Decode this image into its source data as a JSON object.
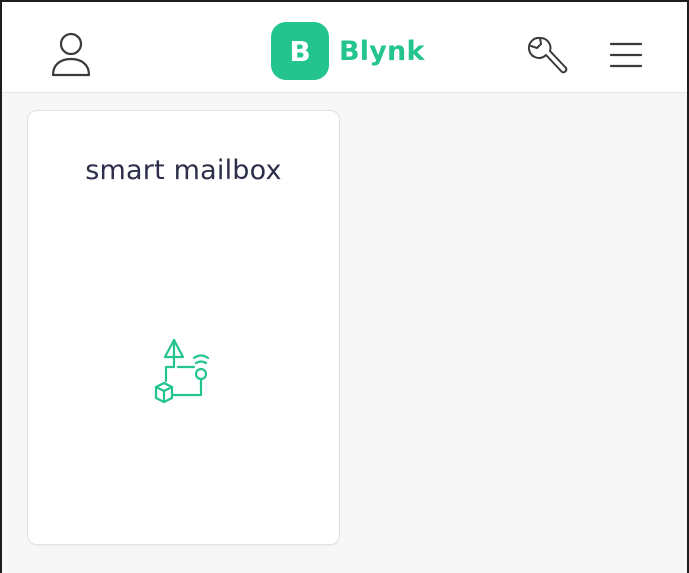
{
  "header": {
    "logo_letter": "B",
    "logo_text": "Blynk",
    "icons": {
      "profile": "user-icon",
      "settings": "wrench-icon",
      "menu": "hamburger-menu-icon"
    }
  },
  "device": {
    "name": "smart mailbox",
    "icon": "device-template-icon"
  },
  "colors": {
    "brand": "#23c48e",
    "title_text": "#2c2e4a",
    "icon_stroke": "#3a3a3a",
    "background": "#f7f7f7"
  }
}
